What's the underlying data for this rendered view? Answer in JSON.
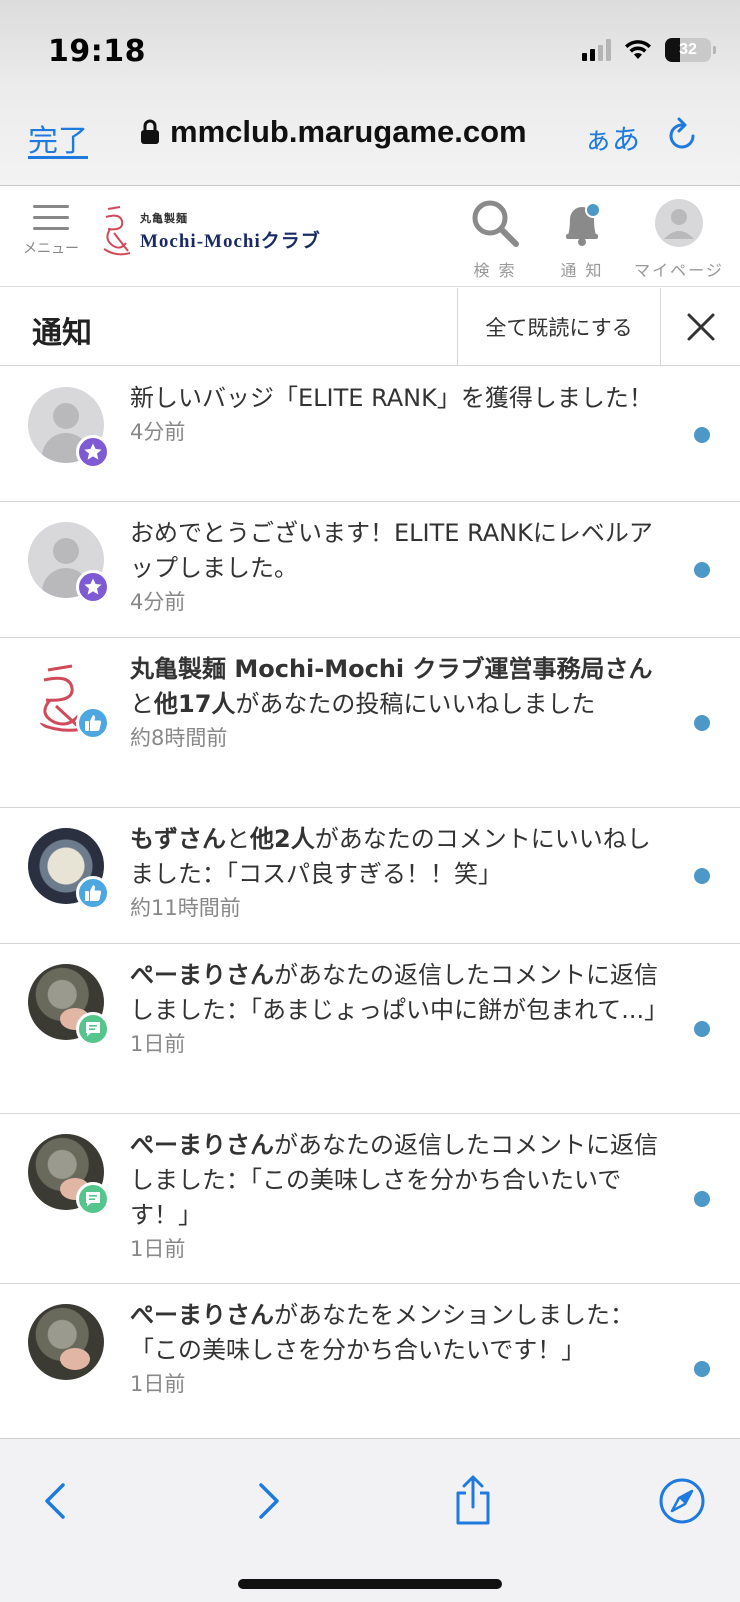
{
  "status_bar": {
    "time": "19:18",
    "battery": "32",
    "battery_level": 0.32
  },
  "browser": {
    "done_label": "完了",
    "url": "mmclub.marugame.com",
    "text_size_label": "ぁあ"
  },
  "site_header": {
    "menu_label": "メニュー",
    "logo_small": "丸亀製麺",
    "logo_main": "Mochi-Mochiクラブ",
    "search_label": "検 索",
    "notif_label": "通 知",
    "mypage_label": "マイページ"
  },
  "notifications_panel": {
    "title": "通知",
    "mark_all_read_label": "全て既読にする"
  },
  "notifications": [
    {
      "avatar": "default",
      "badge": "star",
      "height": 135,
      "actor": "",
      "actor_suffix": "",
      "others": "",
      "text": "新しいバッジ「ELITE RANK」を獲得しました！",
      "time": "4分前",
      "unread": true
    },
    {
      "avatar": "default",
      "badge": "star",
      "height": 136,
      "actor": "",
      "actor_suffix": "",
      "others": "",
      "text": "おめでとうございます！ELITE RANKにレベルアップしました。",
      "time": "4分前",
      "unread": true
    },
    {
      "avatar": "logo",
      "badge": "like",
      "height": 170,
      "actor": "丸亀製麺 Mochi-Mochi クラブ運営事務局さん",
      "actor_suffix": "と",
      "others": "他17人",
      "text": "があなたの投稿にいいねしました",
      "time": "約8時間前",
      "unread": true
    },
    {
      "avatar": "food",
      "badge": "like",
      "height": 136,
      "actor": "もずさん",
      "actor_suffix": "と",
      "others": "他2人",
      "text": "があなたのコメントにいいねしました：「コスパ良すぎる！！笑」",
      "time": "約11時間前",
      "unread": true
    },
    {
      "avatar": "cat",
      "badge": "comment",
      "height": 170,
      "actor": "ぺーまりさん",
      "actor_suffix": "",
      "others": "",
      "text": "があなたの返信したコメントに返信しました：「あまじょっぱい中に餅が包まれて...」",
      "time": "1日前",
      "unread": true
    },
    {
      "avatar": "cat",
      "badge": "comment",
      "height": 170,
      "actor": "ぺーまりさん",
      "actor_suffix": "",
      "others": "",
      "text": "があなたの返信したコメントに返信しました：「この美味しさを分かち合いたいです！」",
      "time": "1日前",
      "unread": true
    },
    {
      "avatar": "cat",
      "badge": "",
      "height": 170,
      "actor": "ぺーまりさん",
      "actor_suffix": "",
      "others": "",
      "text": "があなたをメンションしました：「この美味しさを分かち合いたいです！」",
      "time": "1日前",
      "unread": true
    }
  ],
  "colors": {
    "ios_blue": "#1f7ae0",
    "unread_dot": "#4c99c8",
    "badge_star": "#7e5bd3",
    "badge_like": "#4ca6e0",
    "badge_comment": "#56c58b"
  },
  "icons": {
    "toolbar": [
      "back-chevron-icon",
      "forward-chevron-icon",
      "share-icon",
      "compass-icon"
    ]
  }
}
